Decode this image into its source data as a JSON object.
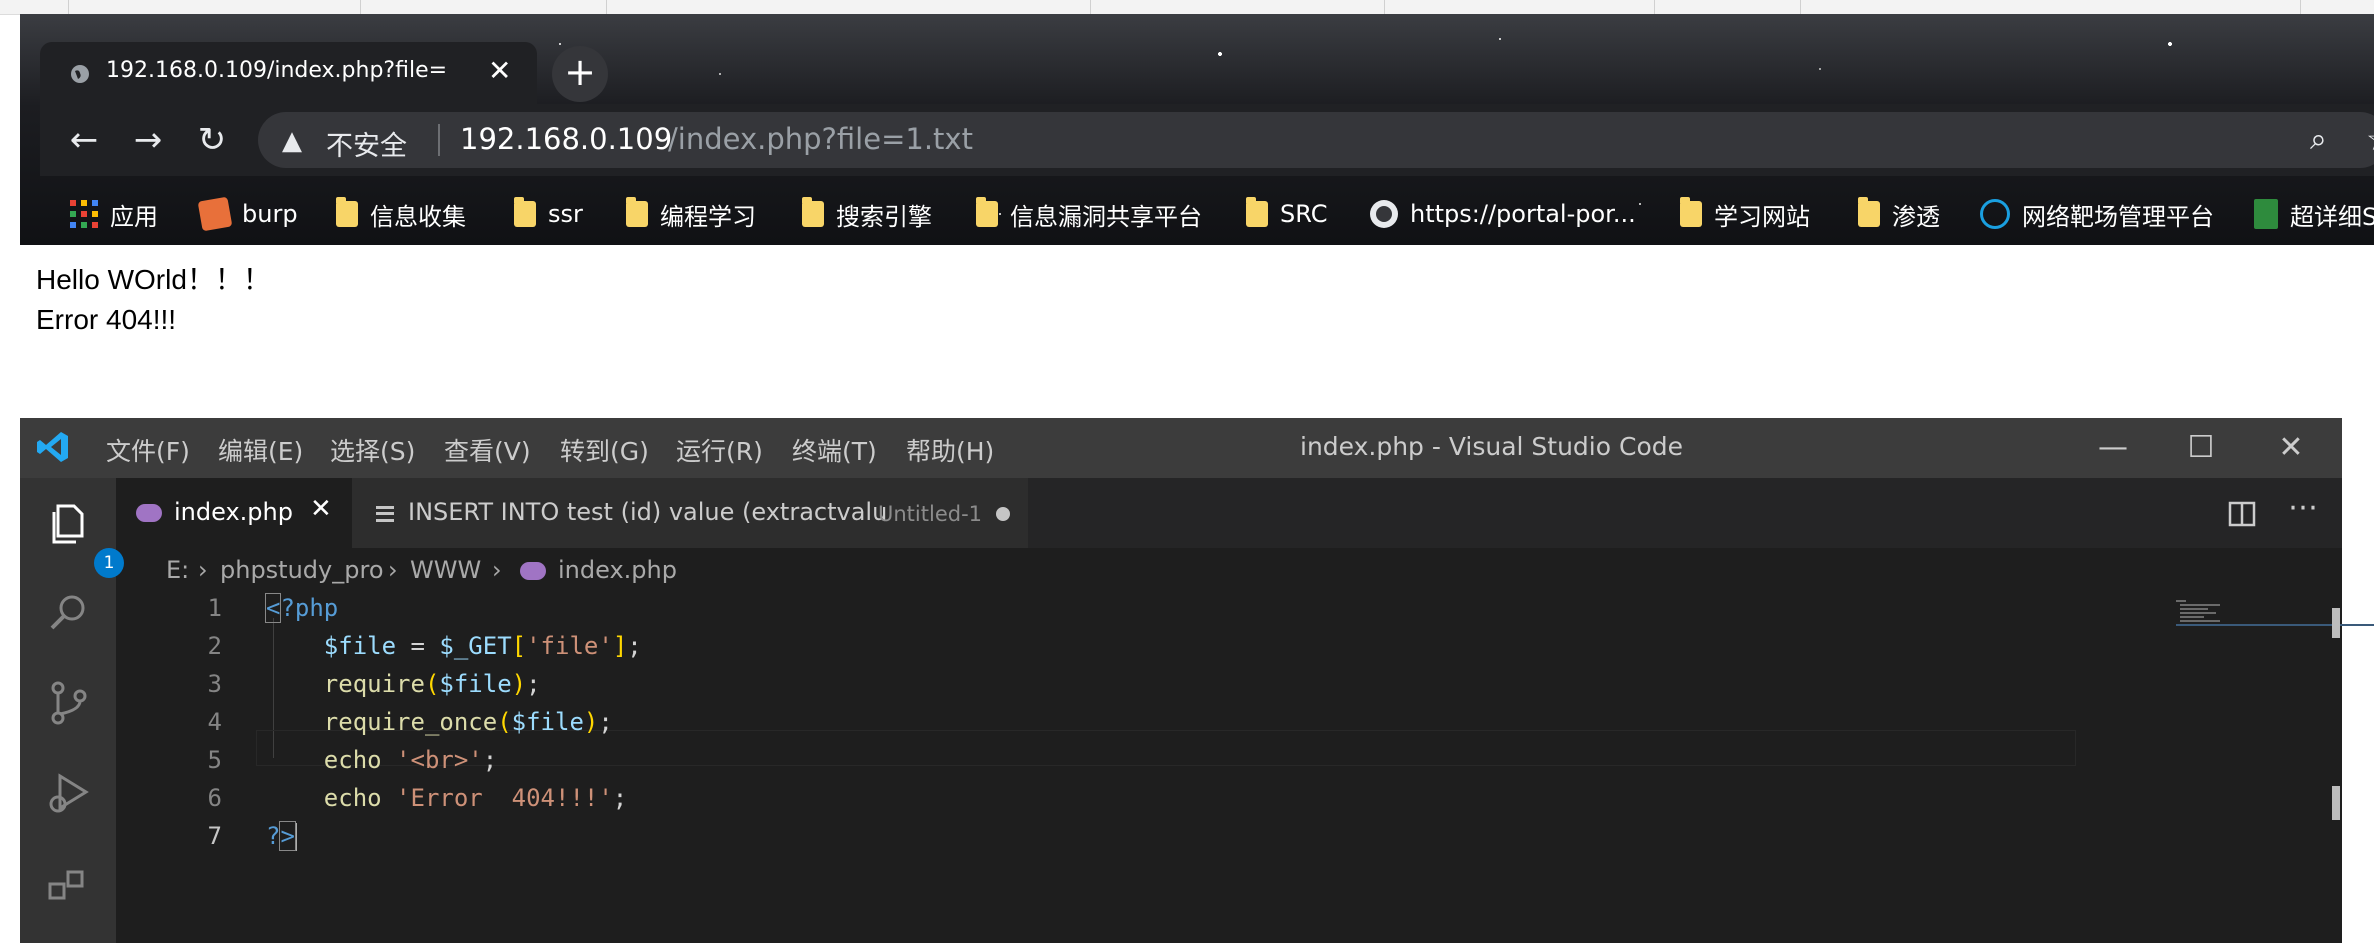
{
  "browser": {
    "tab_title": "192.168.0.109/index.php?file=",
    "new_tab_symbol": "+",
    "security_label": "不安全",
    "url_host": "192.168.0.109",
    "url_path": "/index.php?file=1.txt",
    "bookmarks": [
      {
        "label": "应用",
        "icon": "apps-icon"
      },
      {
        "label": "burp",
        "icon": "burp-icon"
      },
      {
        "label": "信息收集",
        "icon": "folder-icon"
      },
      {
        "label": "ssr",
        "icon": "folder-icon"
      },
      {
        "label": "编程学习",
        "icon": "folder-icon"
      },
      {
        "label": "搜索引擎",
        "icon": "folder-icon"
      },
      {
        "label": "信息漏洞共享平台",
        "icon": "folder-icon"
      },
      {
        "label": "SRC",
        "icon": "folder-icon"
      },
      {
        "label": "https://portal-por...",
        "icon": "globe-icon"
      },
      {
        "label": "学习网站",
        "icon": "folder-icon"
      },
      {
        "label": "渗透",
        "icon": "folder-icon"
      },
      {
        "label": "网络靶场管理平台",
        "icon": "target-icon"
      },
      {
        "label": "超详细SQ",
        "icon": "sheet-icon"
      }
    ]
  },
  "page": {
    "line1": "Hello WOrld！！！",
    "line2": "Error 404!!!"
  },
  "vscode": {
    "menu": [
      "文件(F)",
      "编辑(E)",
      "选择(S)",
      "查看(V)",
      "转到(G)",
      "运行(R)",
      "终端(T)",
      "帮助(H)"
    ],
    "window_title": "index.php - Visual Studio Code",
    "explorer_badge": "1",
    "tabs": [
      {
        "label": "index.php",
        "active": true
      },
      {
        "label": "INSERT INTO test (id) value (extractvalu",
        "detail": "Untitled-1",
        "modified": true
      }
    ],
    "breadcrumb": [
      "E:",
      "phpstudy_pro",
      "WWW",
      "index.php"
    ],
    "line_numbers": [
      "1",
      "2",
      "3",
      "4",
      "5",
      "6",
      "7"
    ],
    "code": {
      "l1_open": "<",
      "l1_rest": "?php",
      "l2_var": "$file",
      "l2_eq": " = ",
      "l2_get": "$_GET",
      "l2_lb": "[",
      "l2_str": "'file'",
      "l2_rb": "]",
      "l2_end": ";",
      "l3_fn": "require",
      "l3_lp": "(",
      "l3_var": "$file",
      "l3_rp": ")",
      "l3_end": ";",
      "l4_fn": "require_once",
      "l4_lp": "(",
      "l4_var": "$file",
      "l4_rp": ")",
      "l4_end": ";",
      "l5_kw": "echo",
      "l5_str": "'<br>'",
      "l5_end": ";",
      "l6_kw": "echo",
      "l6_str": "'Error  404!!!'",
      "l6_end": ";",
      "l7_q": "?",
      "l7_close": ">"
    }
  }
}
